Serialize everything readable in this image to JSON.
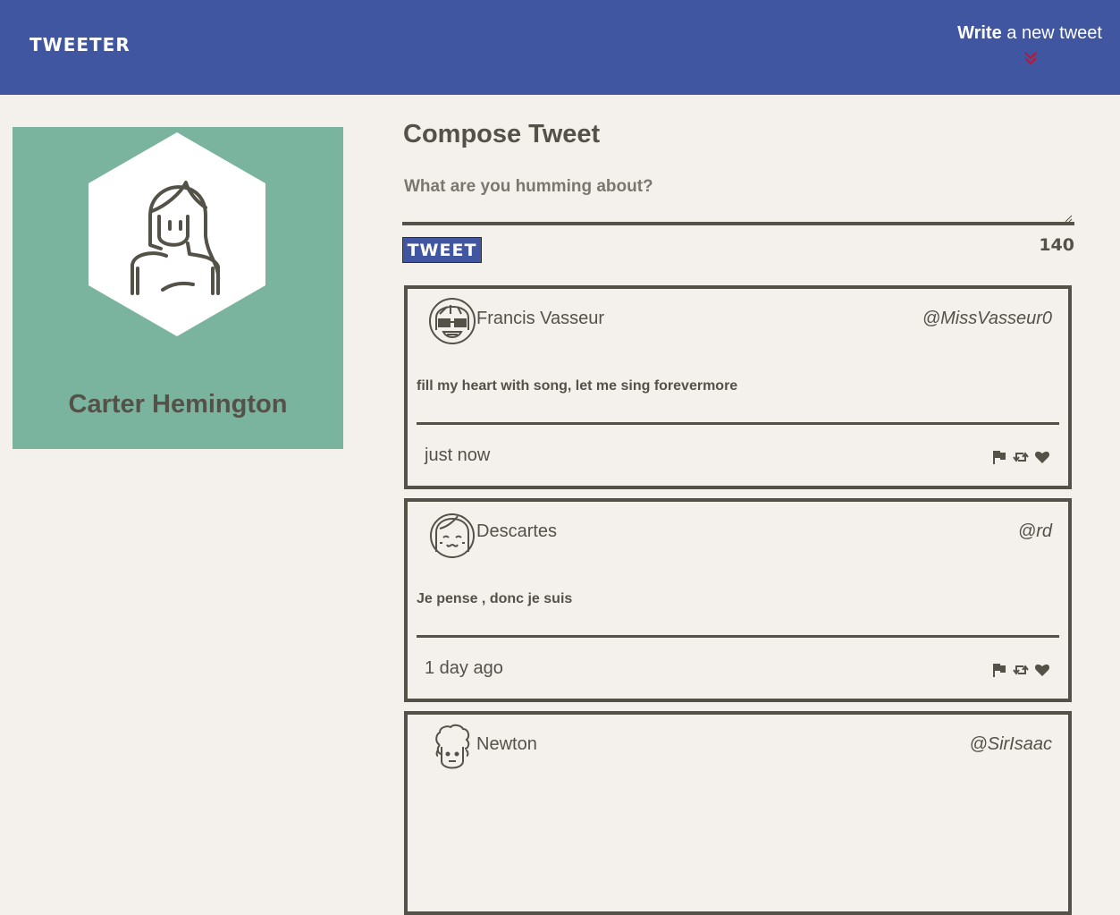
{
  "nav": {
    "brand": "TWEETER",
    "compose_bold": "Write",
    "compose_rest": " a new tweet",
    "toggle_icon": "double-chevron-down-icon",
    "toggle_color": "#c8102e"
  },
  "profile": {
    "name": "Carter Hemington",
    "avatar_icon": "girl-avatar-icon",
    "background": "#7bb49e"
  },
  "compose": {
    "title": "Compose Tweet",
    "placeholder": "What are you humming about?",
    "button_label": "TWEET",
    "counter": "140"
  },
  "tweets": [
    {
      "author": "Francis Vasseur",
      "handle": "@MissVasseur0",
      "text": "fill my heart with song, let me sing forevermore",
      "time": "just now",
      "avatar_icon": "sunglasses-avatar-icon"
    },
    {
      "author": "Descartes",
      "handle": "@rd",
      "text": "Je pense , donc je suis",
      "time": "1 day ago",
      "avatar_icon": "smiling-girl-avatar-icon"
    },
    {
      "author": "Newton",
      "handle": "@SirIsaac",
      "text": "",
      "time": "",
      "avatar_icon": "curly-hair-avatar-icon"
    }
  ],
  "actions": [
    "flag-icon",
    "retweet-icon",
    "heart-icon"
  ],
  "colors": {
    "nav": "#4056a1",
    "background": "#f4f1ec",
    "text": "#545149"
  }
}
